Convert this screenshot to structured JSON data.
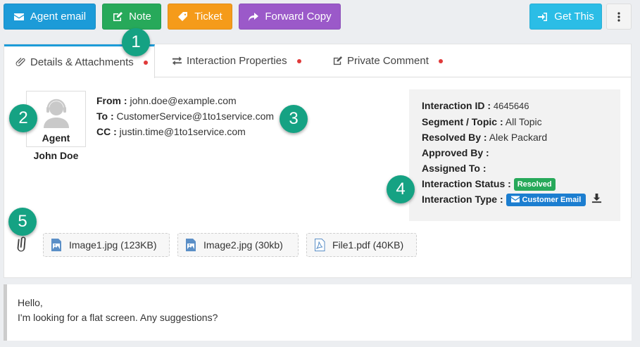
{
  "toolbar": {
    "agent_email": "Agent email",
    "note": "Note",
    "ticket": "Ticket",
    "forward_copy": "Forward Copy",
    "get_this": "Get This",
    "more_icon": "vertical-ellipsis-icon"
  },
  "tabs": [
    {
      "label": "Details & Attachments",
      "icon": "paperclip-icon"
    },
    {
      "label": "Interaction Properties",
      "icon": "exchange-icon"
    },
    {
      "label": "Private Comment",
      "icon": "edit-icon"
    }
  ],
  "agent": {
    "role": "Agent",
    "name": "John Doe"
  },
  "email_headers": {
    "from_label": "From :",
    "from": "john.doe@example.com",
    "to_label": "To :",
    "to": "CustomerService@1to1service.com",
    "cc_label": "CC :",
    "cc": "justin.time@1to1service.com"
  },
  "interaction": {
    "id_label": "Interaction ID :",
    "id": "4645646",
    "segment_label": "Segment / Topic :",
    "segment": "All Topic",
    "resolved_by_label": "Resolved By :",
    "resolved_by": "Alek Packard",
    "approved_by_label": "Approved By :",
    "approved_by": "",
    "assigned_to_label": "Assigned To :",
    "assigned_to": "",
    "status_label": "Interaction Status :",
    "status": "Resolved",
    "type_label": "Interaction Type :",
    "type": "Customer Email"
  },
  "attachments": [
    {
      "name": "Image1.jpg (123KB)",
      "icon": "image-file-icon"
    },
    {
      "name": "Image2.jpg (30kb)",
      "icon": "image-file-icon"
    },
    {
      "name": "File1.pdf (40KB)",
      "icon": "pdf-file-icon"
    }
  ],
  "message": {
    "line1": "Hello,",
    "line2": "I'm looking for a flat screen. Any suggestions?"
  },
  "callouts": [
    "1",
    "2",
    "3",
    "4",
    "5"
  ],
  "colors": {
    "email": "#1c9bd8",
    "note": "#27a95a",
    "ticket": "#f59b1a",
    "forward": "#9b59c9",
    "get_this": "#2bbde6",
    "callout": "#15a283",
    "resolved": "#27a95a",
    "customer_email": "#1c7ed0"
  }
}
